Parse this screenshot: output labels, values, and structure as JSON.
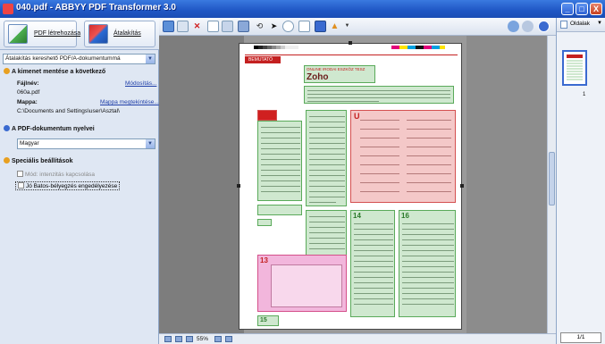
{
  "window": {
    "title": "040.pdf - ABBYY PDF Transformer 3.0",
    "minimize": "_",
    "maximize": "□",
    "close": "X"
  },
  "left_panel": {
    "pdf_create_label": "PDF ​​​létrehozása",
    "convert_label": "Átalakítás",
    "mode_select": "Átalakítás kereshető PDF/A-dokumentummá",
    "save_section": "A kimenet mentése a következő",
    "file_name_label": "Fájlnév:",
    "file_name_link": "Módosítás...",
    "file_name_value": "060a.pdf",
    "folder_label": "Mappa:",
    "folder_link": "Mappa megtekintése...",
    "folder_value": "C:\\Documents and Settings\\user\\Asztal\\",
    "language_section": "A PDF-dokumentum nyelvei",
    "language_select": "Magyar",
    "special_section": "Speciális beállítások",
    "option_1": "Mód: intenzitás kapcsolása",
    "option_2": "Jó Batos-bélyegzés engedélyezése"
  },
  "toolbar": {
    "icons": [
      "save-icon",
      "scan-icon",
      "delete-icon",
      "page-icon",
      "layout-icon",
      "rotate-icon",
      "pointer-icon",
      "select-icon",
      "hand-icon",
      "image-icon",
      "stamp-icon"
    ]
  },
  "page": {
    "header_tag": "BEMUTATÓ",
    "kicker": "ONLINE IRODAI ESZKÖZ TESZ",
    "heading": "Zoho",
    "label_13": "13",
    "label_14": "14",
    "label_15": "15",
    "label_16": "16"
  },
  "statusbar": {
    "zoom": "55%"
  },
  "right_panel": {
    "pages_label": "Oldalak",
    "thumb_number": "1",
    "page_count": "1/1"
  },
  "colors": {
    "title_bar": "#1f56c4",
    "green_region": "#cfe8cf",
    "red_region": "#f4c8c8",
    "magenta_region": "#f2b6dc"
  }
}
